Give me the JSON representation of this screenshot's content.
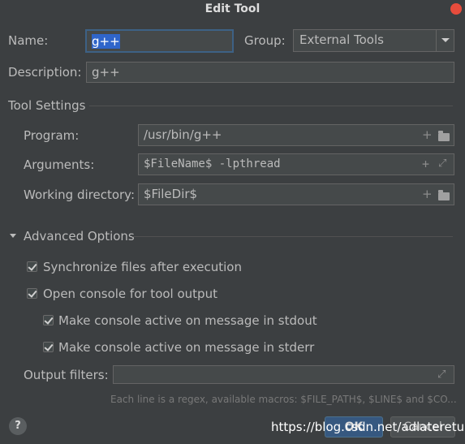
{
  "dialog": {
    "title": "Edit Tool"
  },
  "name": {
    "label": "Name:",
    "value": "g++"
  },
  "group": {
    "label": "Group:",
    "value": "External Tools"
  },
  "description": {
    "label": "Description:",
    "value": "g++"
  },
  "tool_settings": {
    "header": "Tool Settings",
    "program": {
      "label": "Program:",
      "value": "/usr/bin/g++"
    },
    "arguments": {
      "label": "Arguments:",
      "value": "$FileName$ -lpthread"
    },
    "working_directory": {
      "label": "Working directory:",
      "value": "$FileDir$"
    }
  },
  "advanced": {
    "header": "Advanced Options",
    "sync_files": {
      "label": "Synchronize files after execution",
      "checked": true
    },
    "open_console": {
      "label": "Open console for tool output",
      "checked": true
    },
    "console_stdout": {
      "label": "Make console active on message in stdout",
      "checked": true
    },
    "console_stderr": {
      "label": "Make console active on message in stderr",
      "checked": true
    },
    "output_filters": {
      "label": "Output filters:",
      "value": ""
    },
    "hint": "Each line is a regex, available macros: $FILE_PATH$, $LINE$ and $CO..."
  },
  "footer": {
    "help": "?",
    "ok": "OK",
    "cancel": "Cancel"
  },
  "watermark": "https://blog.csdn.net/adlatereturn"
}
